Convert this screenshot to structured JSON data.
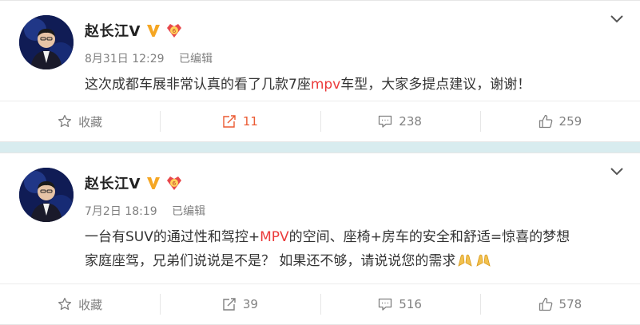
{
  "posts": [
    {
      "author": "赵长江V",
      "date": "8月31日",
      "time": "12:29",
      "edited": "已编辑",
      "text_parts": [
        "这次成都车展非常认真的看了几款7座",
        "mpv",
        "车型，大家多提点建议，谢谢！"
      ],
      "line2": "",
      "actions": {
        "favorite": "收藏",
        "repost": "11",
        "comment": "238",
        "like": "259"
      }
    },
    {
      "author": "赵长江V",
      "date": "7月2日",
      "time": "18:19",
      "edited": "已编辑",
      "text_parts": [
        "一台有SUV的通过性和驾控+",
        "MPV",
        "的空间、座椅+房车的安全和舒适=惊喜的梦想"
      ],
      "line2": "家庭座驾，兄弟们说说是不是？ 如果还不够，请说说您的需求",
      "actions": {
        "favorite": "收藏",
        "repost": "39",
        "comment": "516",
        "like": "578"
      }
    }
  ],
  "colors": {
    "accent": "#eb5a32",
    "highlight": "#eb3b3b",
    "background": "#d8ecef",
    "muted": "#808080"
  },
  "icons": [
    "chevron-down-icon",
    "verified-v-icon",
    "rank-badge-icon",
    "star-icon",
    "repost-icon",
    "comment-icon",
    "like-icon",
    "pray-hands-icon"
  ]
}
